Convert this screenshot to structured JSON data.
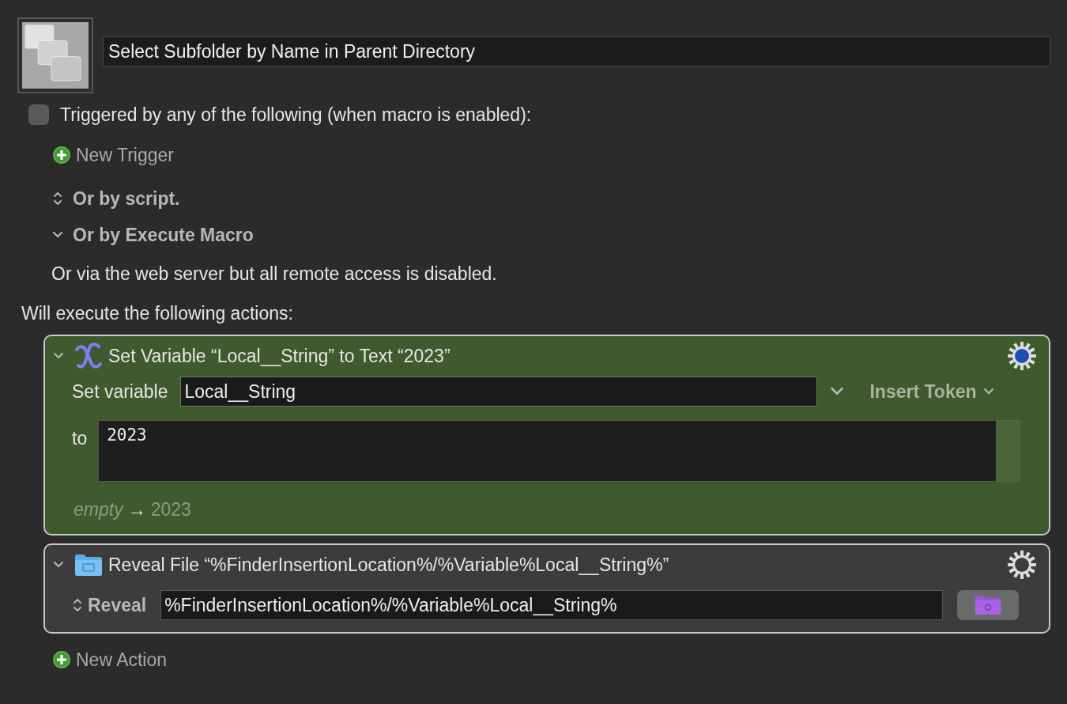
{
  "macro": {
    "name": "Select Subfolder by Name in Parent Directory"
  },
  "triggers": {
    "label": "Triggered by any of the following (when macro is enabled):",
    "checked": false,
    "new_trigger": "New Trigger",
    "options": [
      {
        "kind": "popup",
        "label": "Or by script."
      },
      {
        "kind": "disclosure",
        "label": "Or by Execute Macro",
        "expanded": true
      }
    ],
    "web_server_note": "Or via the web server but all remote access is disabled."
  },
  "actions_heading": "Will execute the following actions:",
  "actions": [
    {
      "kind": "set_variable",
      "title": "Set Variable “Local__String” to Text “2023”",
      "expanded": true,
      "selected": true,
      "variable_label": "Set variable",
      "variable": "Local__String",
      "insert_token": "Insert Token",
      "to_label": "to",
      "text": "2023",
      "preview_from": "empty",
      "preview_arrow": "→",
      "preview_to": "2023"
    },
    {
      "kind": "reveal_file",
      "title": "Reveal File “%FinderInsertionLocation%/%Variable%Local__String%”",
      "expanded": true,
      "selected": false,
      "mode": "Reveal",
      "path": "%FinderInsertionLocation%/%Variable%Local__String%"
    }
  ],
  "new_action": "New Action"
}
